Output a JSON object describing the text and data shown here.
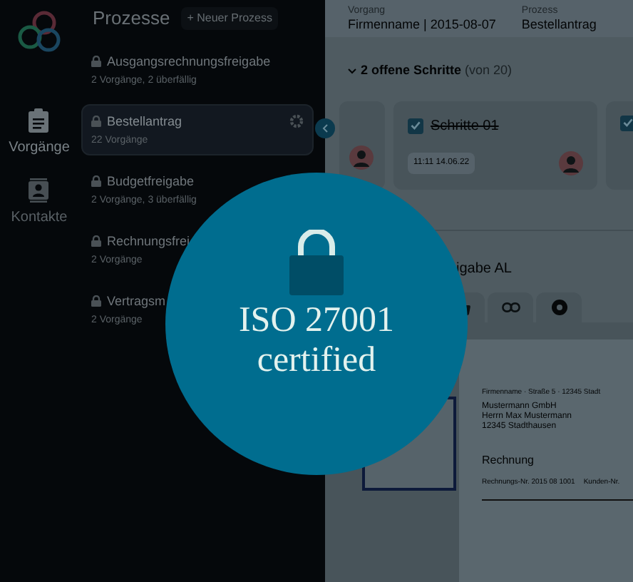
{
  "app_nav": [
    {
      "label": "Vorgänge",
      "kind": "clipboard",
      "selected": true
    },
    {
      "label": "Kontakte",
      "kind": "contact",
      "selected": false
    }
  ],
  "processes": {
    "title": "Prozesse",
    "new_button": "+ Neuer Prozess",
    "items": [
      {
        "name": "Ausgangsrechnungsfreigabe",
        "info": "2 Vorgänge, 2 überfällig",
        "selected": false
      },
      {
        "name": "Bestellantrag",
        "info": "22 Vorgänge",
        "selected": true
      },
      {
        "name": "Budgetfreigabe",
        "info": "2 Vorgänge, 3 überfällig",
        "selected": false
      },
      {
        "name": "Rechnungsfrei",
        "info": "2 Vorgänge",
        "selected": false
      },
      {
        "name": "Vertragsm",
        "info": "2 Vorgänge",
        "selected": false
      }
    ]
  },
  "details": {
    "fields": [
      {
        "label": "Vorgang",
        "value": "Firmenname | 2015-08-07"
      },
      {
        "label": "Prozess",
        "value": "Bestellantrag"
      }
    ],
    "steps_heading": "2 offene Schritte",
    "steps_count": "(von 20)",
    "step": {
      "title": "Schritte 01",
      "done": true,
      "time": "11:11 14.06.22"
    },
    "next_step": {
      "done": true
    },
    "section_heading": "igabe AL",
    "tabs": [
      {
        "kind": "thumb",
        "selected": false
      },
      {
        "kind": "link",
        "selected": false
      },
      {
        "kind": "dot",
        "selected": false
      }
    ],
    "document": {
      "sender": "Firmenname · Straße 5 · 12345 Stadt",
      "address": [
        "Mustermann GmbH",
        "Herrn Max Mustermann",
        "12345 Stadthausen"
      ],
      "title": "Rechnung",
      "number": "Rechnungs-Nr. 2015 08 1001",
      "customer": "Kunden-Nr."
    }
  },
  "badge": {
    "line1": "ISO 27001",
    "line2": "certified"
  }
}
